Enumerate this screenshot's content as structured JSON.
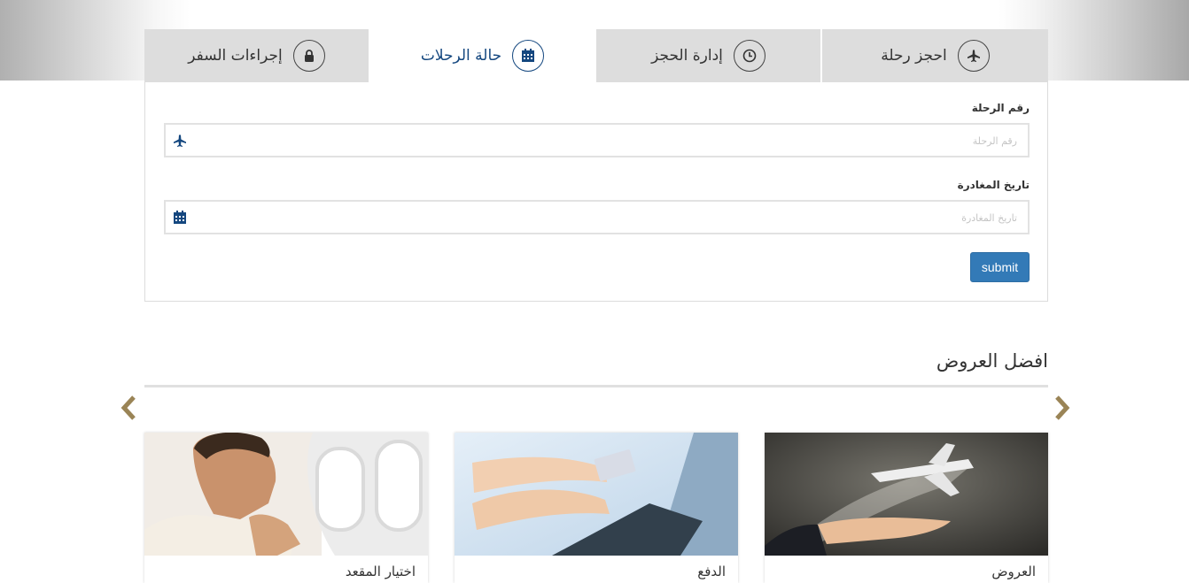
{
  "tabs": [
    {
      "label": "احجز رحلة",
      "icon": "plane-icon"
    },
    {
      "label": "إدارة الحجز",
      "icon": "clock-icon"
    },
    {
      "label": "حالة الرحلات",
      "icon": "calendar-icon",
      "active": true
    },
    {
      "label": "إجراءات السفر",
      "icon": "lock-icon"
    }
  ],
  "form": {
    "flight_number_label": "رقم الرحلة",
    "flight_number_placeholder": "رقم الرحلة",
    "departure_date_label": "تاريخ المغادرة",
    "departure_date_placeholder": "تاريخ المغادرة",
    "submit_label": "submit"
  },
  "offers": {
    "title": "افضل العروض",
    "prev_icon": "chevron-left-icon",
    "next_icon": "chevron-right-icon",
    "cards": [
      {
        "image": "plane-over-hand-photo",
        "caption": "العروض"
      },
      {
        "image": "laptop-credit-card-photo",
        "caption": "الدفع"
      },
      {
        "image": "man-in-airplane-seat-photo",
        "caption": "اختيار المقعد"
      }
    ]
  },
  "colors": {
    "accent": "#14477f",
    "button": "#337ab7",
    "tab_bg": "#dddddd",
    "arrow": "#9a8456"
  }
}
